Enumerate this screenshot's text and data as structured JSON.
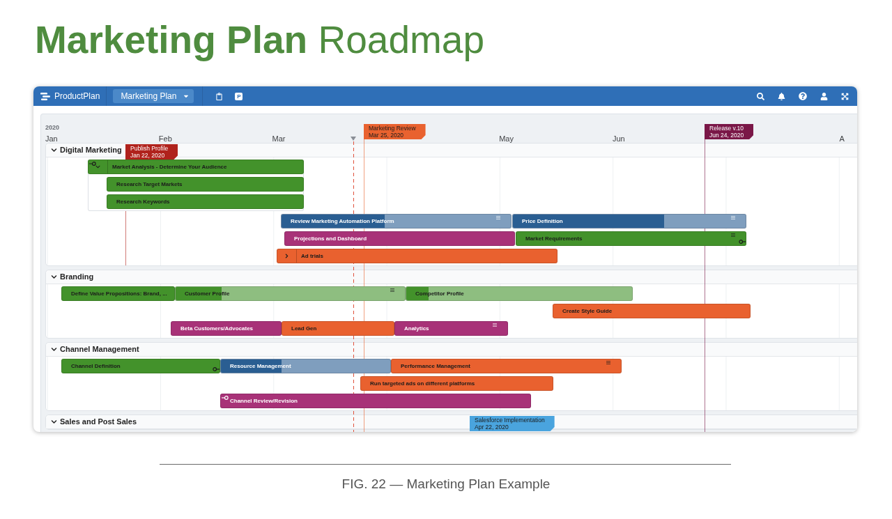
{
  "page_title": "**Marketing Plan** Roadmap",
  "app": {
    "brand": "ProductPlan",
    "plan_selector": "Marketing Plan",
    "letter_badge": "P",
    "timeline": {
      "year": "2020",
      "months": [
        "Jan",
        "Feb",
        "Mar",
        "May",
        "Jun",
        "A"
      ],
      "milestones": [
        {
          "title": "Marketing Review",
          "date": "Mar 25, 2020",
          "color": "#e9622f"
        },
        {
          "title": "Release v.10",
          "date": "Jun 24, 2020",
          "color": "#7a1747"
        }
      ],
      "lanes": [
        {
          "title": "Digital Marketing",
          "expanded": true,
          "milestones": [
            {
              "title": "Publish Profile",
              "date": "Jan 22, 2020",
              "color": "#b0221c"
            }
          ],
          "rows": [
            {
              "bars": [
                {
                  "kind": "group",
                  "label": "Market Analysis - Determine Your Audience",
                  "color": "#43922b",
                  "expanded": true,
                  "notes": false,
                  "dependency_start": true,
                  "children": [
                    {
                      "kind": "task",
                      "label": "Research Target Markets",
                      "color": "#43922b",
                      "notes": false
                    },
                    {
                      "kind": "task",
                      "label": "Research Keywords",
                      "color": "#43922b",
                      "notes": false
                    }
                  ]
                }
              ]
            },
            {
              "bars": [
                {
                  "kind": "task",
                  "label": "Review Marketing Automation Platform",
                  "color": "#2a5e92",
                  "level": 0.45,
                  "notes": true
                },
                {
                  "kind": "task",
                  "label": "Price Definition",
                  "color": "#2a5e92",
                  "level": 0.65,
                  "notes": true
                }
              ]
            },
            {
              "bars": [
                {
                  "kind": "task",
                  "label": "Projections and Dashboard",
                  "color": "#a83278",
                  "notes": false
                },
                {
                  "kind": "task",
                  "label": "Market Requirements",
                  "color": "#43922b",
                  "notes": true,
                  "dependency_end": true
                }
              ]
            },
            {
              "bars": [
                {
                  "kind": "group",
                  "label": "Ad trials",
                  "color": "#e9612f",
                  "expanded": false,
                  "notes": false
                }
              ]
            }
          ]
        },
        {
          "title": "Branding",
          "expanded": true,
          "rows": [
            {
              "bars": [
                {
                  "kind": "task",
                  "label": "Define Value Propositions: Brand, ...",
                  "color": "#43922b",
                  "notes": false
                },
                {
                  "kind": "task",
                  "label": "Customer Profile",
                  "color": "#43922b",
                  "level": 0.2,
                  "notes": true
                },
                {
                  "kind": "task",
                  "label": "Competitor Profile",
                  "color": "#43922b",
                  "level": 0.1,
                  "notes": false
                }
              ]
            },
            {
              "bars": [
                {
                  "kind": "task",
                  "label": "Create Style Guide",
                  "color": "#e9612f",
                  "notes": false
                }
              ]
            },
            {
              "bars": [
                {
                  "kind": "task",
                  "label": "Beta Customers/Advocates",
                  "color": "#a83278",
                  "notes": false
                },
                {
                  "kind": "task",
                  "label": "Lead Gen",
                  "color": "#e9612f",
                  "notes": false
                },
                {
                  "kind": "task",
                  "label": "Analytics",
                  "color": "#a83278",
                  "notes": true
                }
              ]
            }
          ]
        },
        {
          "title": "Channel Management",
          "expanded": true,
          "rows": [
            {
              "bars": [
                {
                  "kind": "task",
                  "label": "Channel Definition",
                  "color": "#43922b",
                  "notes": false,
                  "dependency_end": true
                },
                {
                  "kind": "task",
                  "label": "Resource Management",
                  "color": "#2a5e92",
                  "level": 0.36,
                  "notes": false
                },
                {
                  "kind": "task",
                  "label": "Performance Management",
                  "color": "#e9612f",
                  "notes": true
                }
              ]
            },
            {
              "bars": [
                {
                  "kind": "task",
                  "label": "Run targeted ads on different platforms",
                  "color": "#e9612f",
                  "notes": false
                }
              ]
            },
            {
              "bars": [
                {
                  "kind": "task",
                  "label": "Channel Review/Revision",
                  "color": "#a83278",
                  "notes": false,
                  "dependency_start": true
                }
              ]
            }
          ]
        },
        {
          "title": "Sales and Post Sales",
          "expanded": true,
          "milestones": [
            {
              "title": "Salesforce Implementation",
              "date": "Apr 22, 2020",
              "color": "#4aa4de"
            }
          ]
        }
      ]
    }
  },
  "caption": "FIG. 22 — Marketing Plan Example"
}
